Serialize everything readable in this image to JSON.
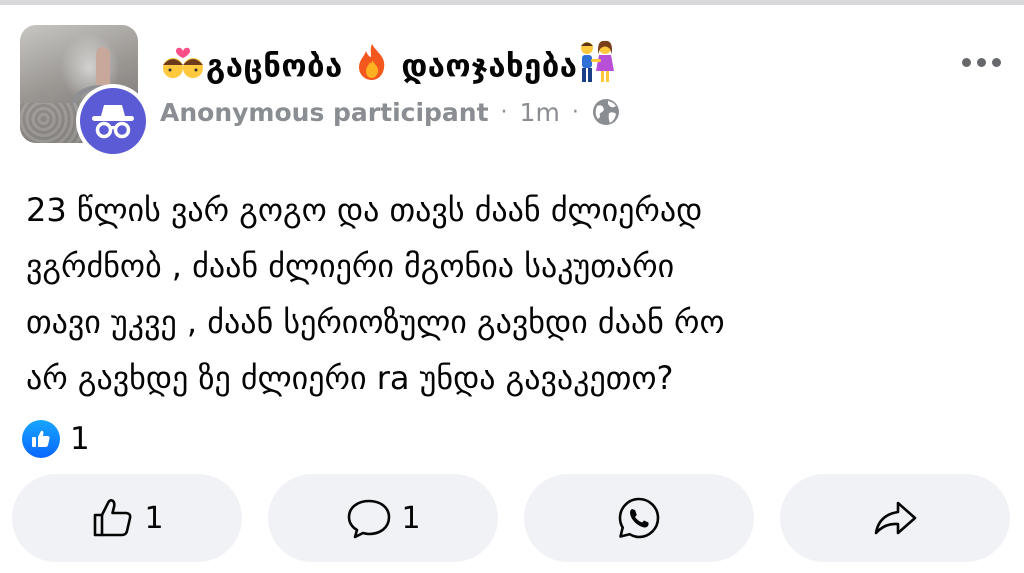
{
  "post": {
    "group_name_part1": "გაცნობა",
    "group_name_part2": "დაოჯახება",
    "author": "Anonymous participant",
    "time": "1m",
    "separator": "·",
    "body": "23 წლის ვარ გოგო და თავს ძაან ძლიერად\nვგრძნობ , ძაან ძლიერი მგონია საკუთარი\nთავი უკვე , ძაან სერიოზული გავხდი ძაან რო\nარ გავხდე ზე ძლიერი ra უნდა გავაკეთო?",
    "reaction_count": "1"
  },
  "actions": {
    "like_count": "1",
    "comment_count": "1"
  },
  "icons": {
    "group_avatar": "group-photo-ring",
    "anon_avatar": "incognito-icon",
    "globe": "globe-icon",
    "more": "more-icon",
    "like": "thumbs-up-icon",
    "comment": "comment-icon",
    "whatsapp": "whatsapp-icon",
    "share": "share-icon"
  },
  "colors": {
    "accent_blue": "#0866ff",
    "anon_purple": "#5b5bd6",
    "button_bg": "#f0f2f5",
    "meta_gray": "#8a8d91"
  }
}
